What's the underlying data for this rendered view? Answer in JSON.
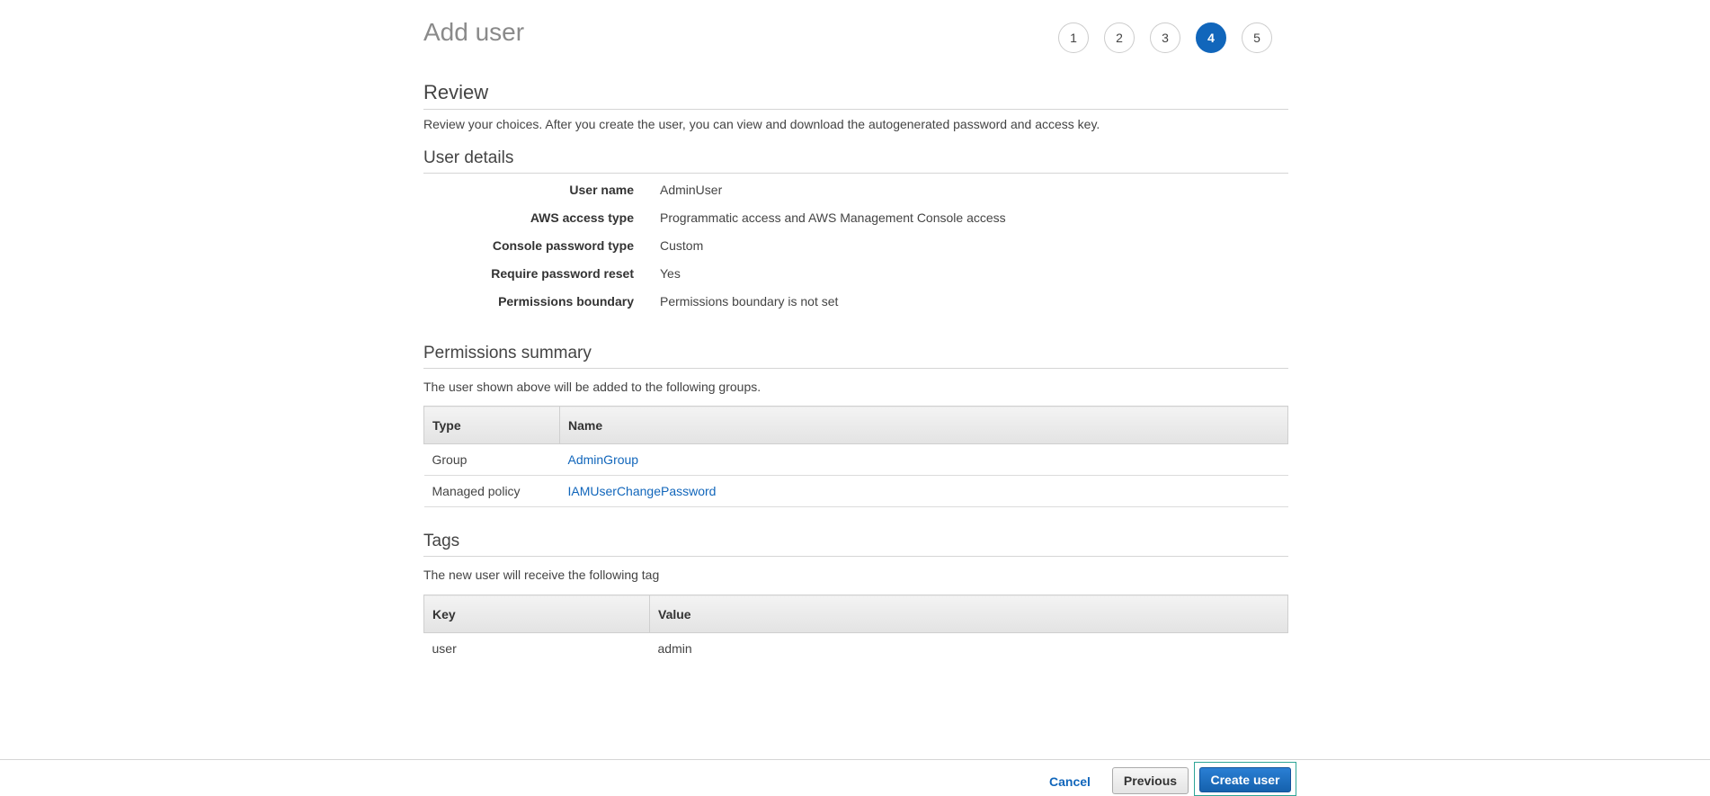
{
  "header": {
    "title": "Add user",
    "steps": [
      "1",
      "2",
      "3",
      "4",
      "5"
    ],
    "active_step": "4"
  },
  "review": {
    "title": "Review",
    "description": "Review your choices. After you create the user, you can view and download the autogenerated password and access key."
  },
  "user_details": {
    "title": "User details",
    "rows": [
      {
        "label": "User name",
        "value": "AdminUser"
      },
      {
        "label": "AWS access type",
        "value": "Programmatic access and AWS Management Console access"
      },
      {
        "label": "Console password type",
        "value": "Custom"
      },
      {
        "label": "Require password reset",
        "value": "Yes"
      },
      {
        "label": "Permissions boundary",
        "value": "Permissions boundary is not set"
      }
    ]
  },
  "permissions": {
    "title": "Permissions summary",
    "description": "The user shown above will be added to the following groups.",
    "columns": [
      "Type",
      "Name"
    ],
    "rows": [
      {
        "type": "Group",
        "name": "AdminGroup"
      },
      {
        "type": "Managed policy",
        "name": "IAMUserChangePassword"
      }
    ]
  },
  "tags": {
    "title": "Tags",
    "description": "The new user will receive the following tag",
    "columns": [
      "Key",
      "Value"
    ],
    "rows": [
      {
        "key": "user",
        "value": "admin"
      }
    ]
  },
  "footer": {
    "cancel_label": "Cancel",
    "previous_label": "Previous",
    "create_label": "Create user"
  },
  "colors": {
    "accent": "#1166bb",
    "focus_outline": "#2ea597"
  }
}
